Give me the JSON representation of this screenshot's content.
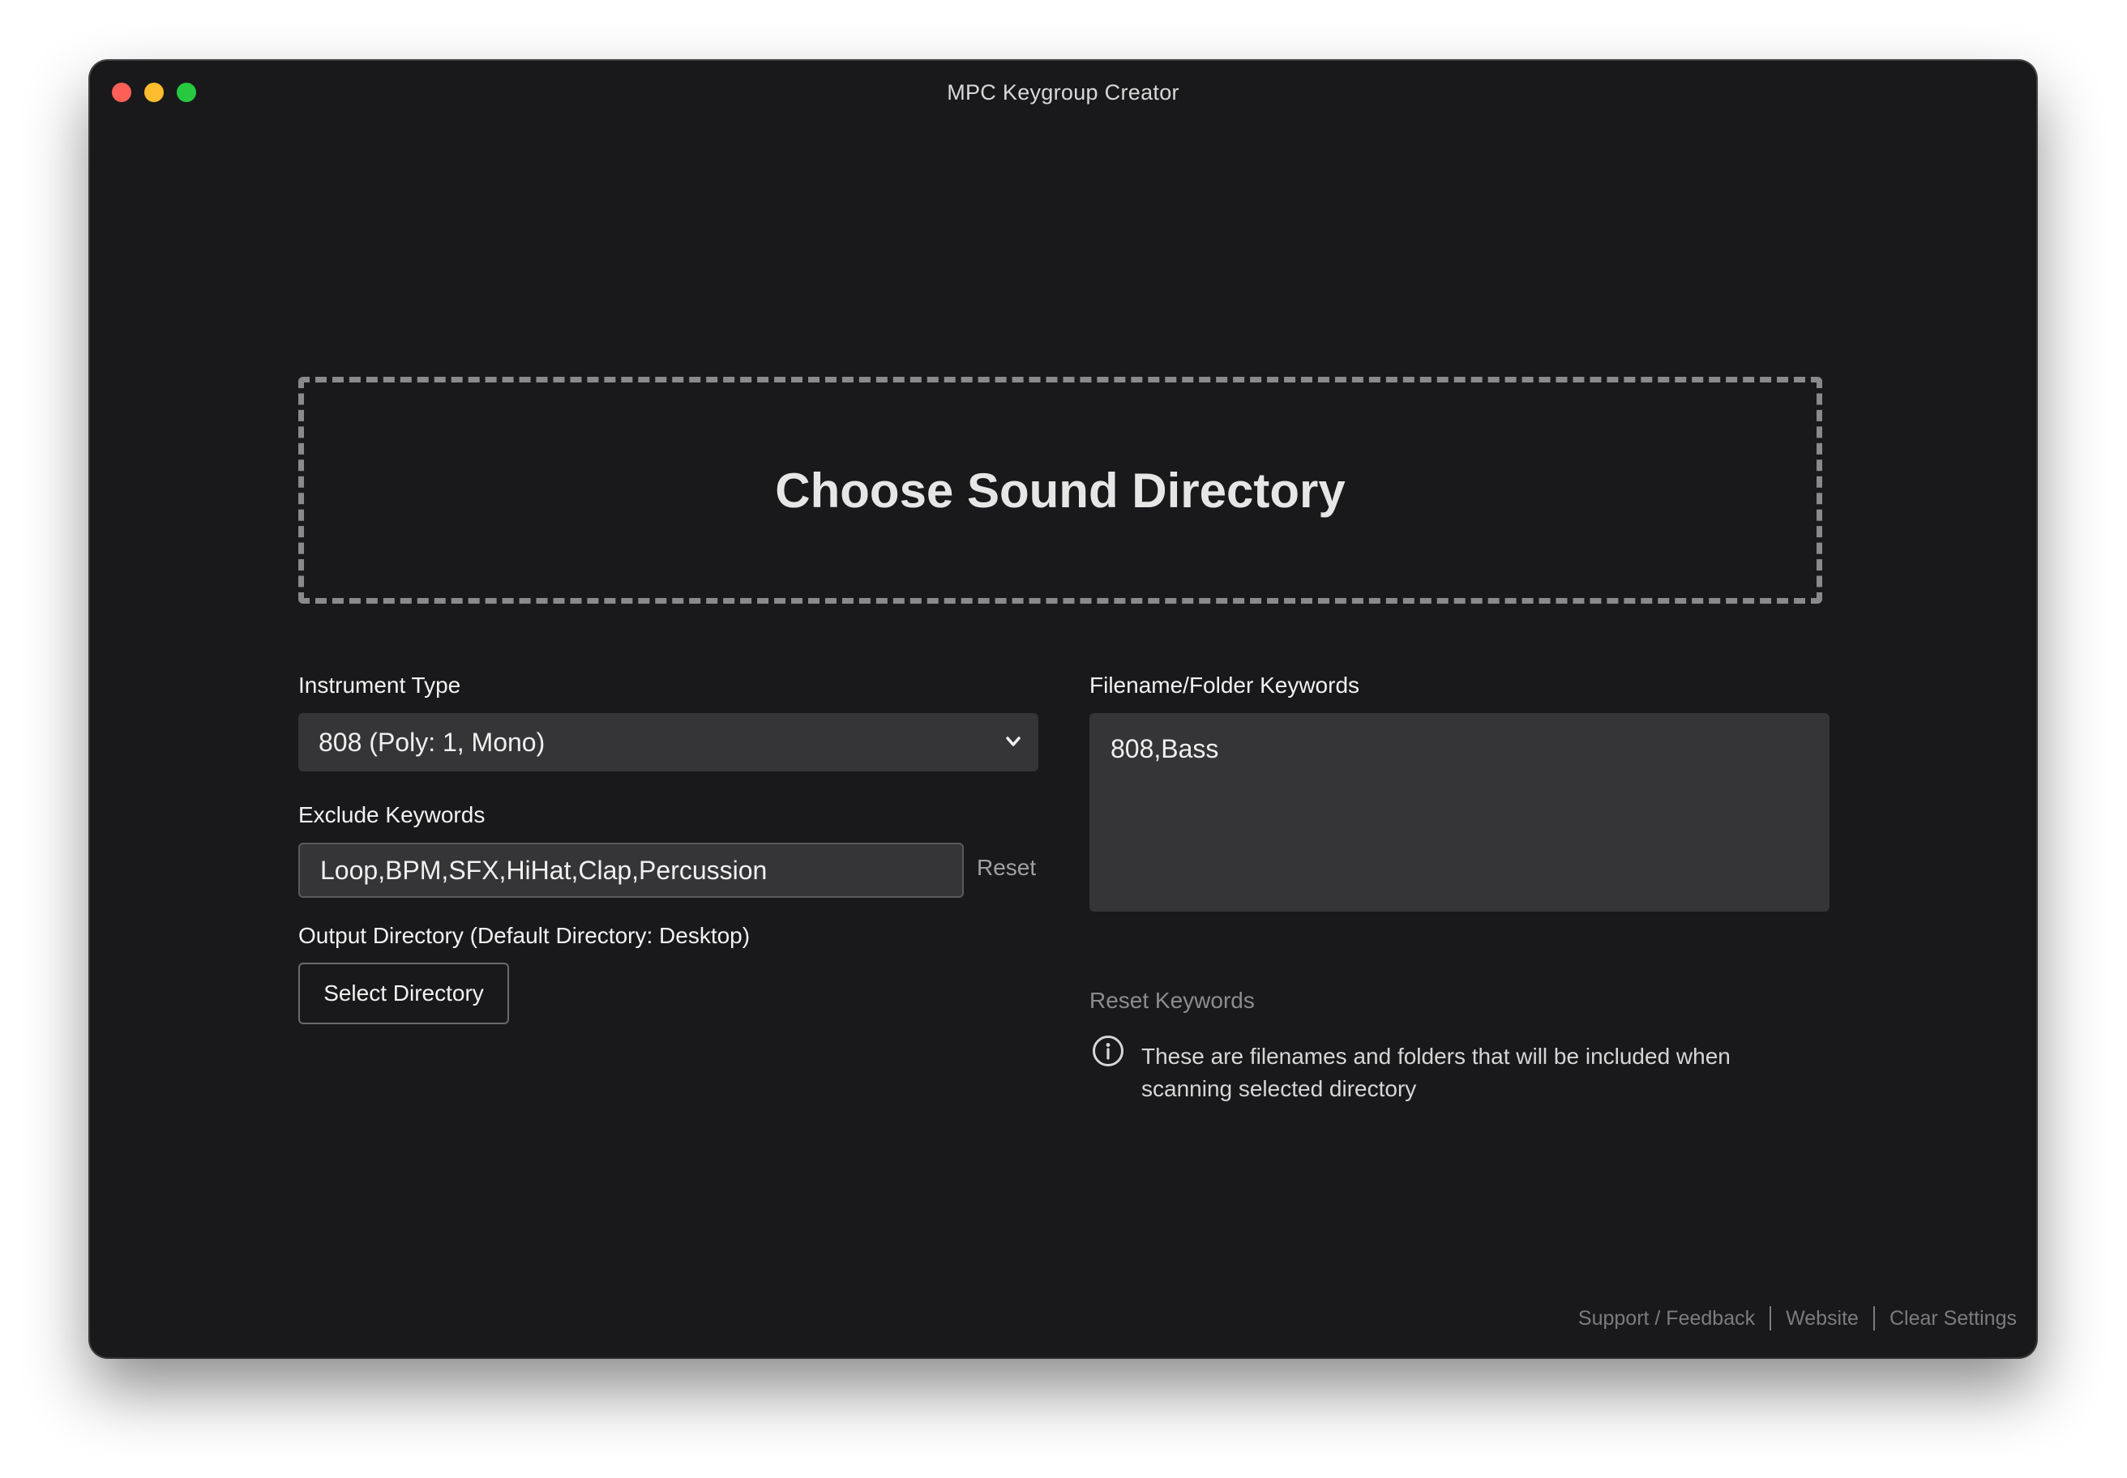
{
  "window": {
    "title": "MPC Keygroup Creator"
  },
  "dropzone": {
    "label": "Choose Sound Directory"
  },
  "instrument": {
    "label": "Instrument Type",
    "selected": "808 (Poly: 1, Mono)"
  },
  "exclude": {
    "label": "Exclude Keywords",
    "value": "Loop,BPM,SFX,HiHat,Clap,Percussion",
    "reset_label": "Reset"
  },
  "output": {
    "label": "Output Directory (Default Directory: Desktop)",
    "button_label": "Select Directory"
  },
  "keywords": {
    "label": "Filename/Folder Keywords",
    "value": "808,Bass",
    "reset_label": "Reset Keywords",
    "info_text": "These are filenames and folders that will be included when scanning selected directory"
  },
  "footer": {
    "support_label": "Support / Feedback",
    "website_label": "Website",
    "clear_label": "Clear Settings"
  },
  "colors": {
    "background": "#19191b",
    "field": "#353537",
    "close": "#fe5f57",
    "minimize": "#febc2e",
    "zoom": "#28c840"
  },
  "icons": [
    "close-dot",
    "minimize-dot",
    "zoom-dot",
    "chevron-down-icon",
    "info-icon"
  ]
}
